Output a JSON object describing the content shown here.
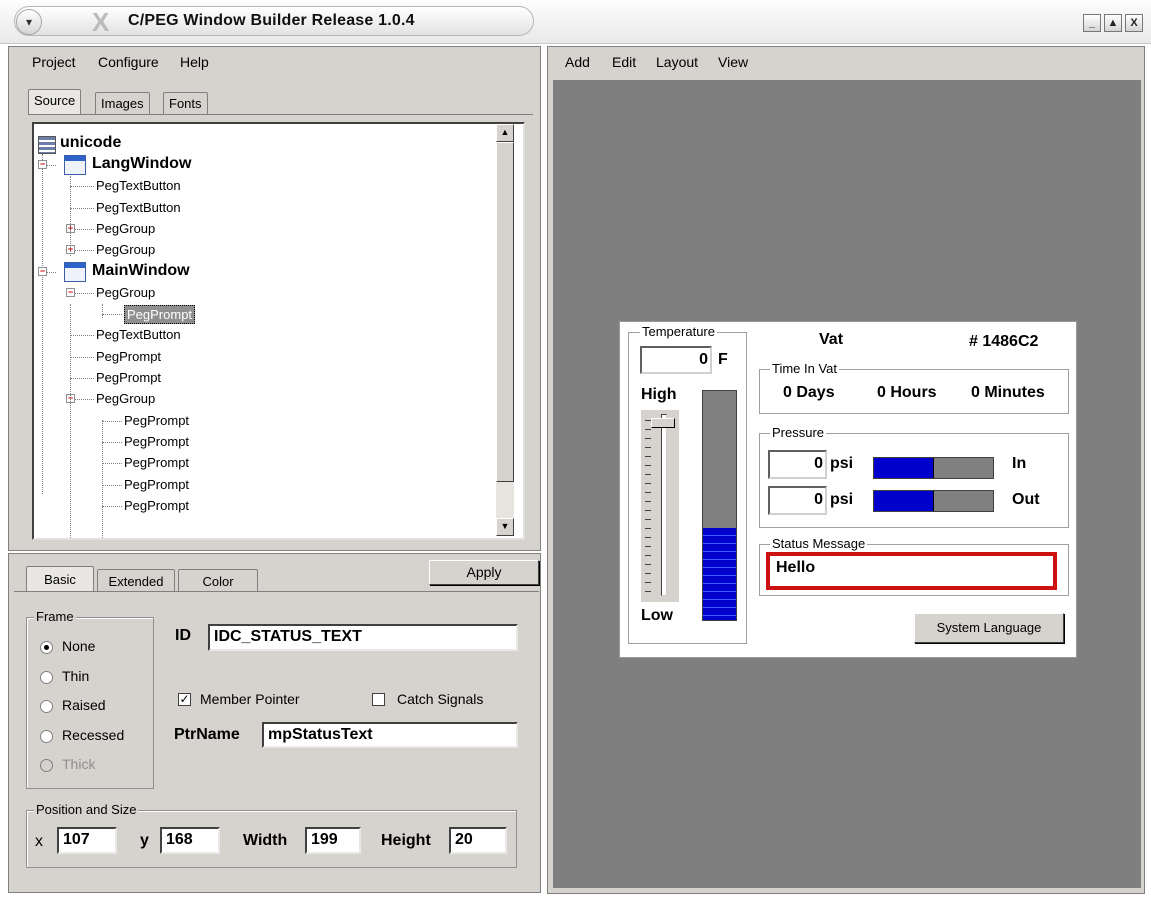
{
  "window": {
    "title": "C/PEG Window Builder Release 1.0.4",
    "logo_glyph": "X",
    "menu_glyph": "▾",
    "minimize_glyph": "_",
    "maximize_glyph": "▲",
    "close_glyph": "X"
  },
  "left_menu": [
    "Project",
    "Configure",
    "Help"
  ],
  "right_menu": [
    "Add",
    "Edit",
    "Layout",
    "View"
  ],
  "top_tabs": {
    "source": "Source",
    "images": "Images",
    "fonts": "Fonts",
    "active": "Source"
  },
  "tree": {
    "root": "unicode",
    "nodes": [
      {
        "label": "LangWindow",
        "level": 0,
        "bold": true,
        "window": true,
        "expander": "−"
      },
      {
        "label": "PegTextButton",
        "level": 1
      },
      {
        "label": "PegTextButton",
        "level": 1
      },
      {
        "label": "PegGroup",
        "level": 1,
        "expander": "+"
      },
      {
        "label": "PegGroup",
        "level": 1,
        "expander": "+"
      },
      {
        "label": "MainWindow",
        "level": 0,
        "bold": true,
        "window": true,
        "expander": "−"
      },
      {
        "label": "PegGroup",
        "level": 1,
        "expander": "−"
      },
      {
        "label": "PegPrompt",
        "level": 2,
        "selected": true
      },
      {
        "label": "PegTextButton",
        "level": 1
      },
      {
        "label": "PegPrompt",
        "level": 1
      },
      {
        "label": "PegPrompt",
        "level": 1
      },
      {
        "label": "PegGroup",
        "level": 1,
        "expander": "−"
      },
      {
        "label": "PegPrompt",
        "level": 2
      },
      {
        "label": "PegPrompt",
        "level": 2
      },
      {
        "label": "PegPrompt",
        "level": 2
      },
      {
        "label": "PegPrompt",
        "level": 2
      },
      {
        "label": "PegPrompt",
        "level": 2
      }
    ]
  },
  "props": {
    "tabs": {
      "basic": "Basic",
      "extended": "Extended",
      "color": "Color",
      "active": "Basic"
    },
    "apply_label": "Apply",
    "frame": {
      "label": "Frame",
      "options": [
        {
          "label": "None",
          "checked": true,
          "disabled": false
        },
        {
          "label": "Thin",
          "checked": false,
          "disabled": false
        },
        {
          "label": "Raised",
          "checked": false,
          "disabled": false
        },
        {
          "label": "Recessed",
          "checked": false,
          "disabled": false
        },
        {
          "label": "Thick",
          "checked": false,
          "disabled": true
        }
      ]
    },
    "id_label": "ID",
    "id_value": "IDC_STATUS_TEXT",
    "member_pointer": {
      "label": "Member Pointer",
      "checked": true,
      "mark": "✓"
    },
    "catch_signals": {
      "label": "Catch Signals",
      "checked": false
    },
    "ptrname_label": "PtrName",
    "ptrname_value": "mpStatusText",
    "position": {
      "label": "Position and Size",
      "x_label": "x",
      "x": "107",
      "y_label": "y",
      "y": "168",
      "width_label": "Width",
      "width": "199",
      "height_label": "Height",
      "height": "20"
    }
  },
  "preview": {
    "temperature": {
      "label": "Temperature",
      "value": "0",
      "unit": "F",
      "high": "High",
      "low": "Low",
      "level": 0.4
    },
    "vat_label": "Vat",
    "vat_id": "# 1486C2",
    "time_in_vat": {
      "label": "Time In Vat",
      "days": "0 Days",
      "hours": "0 Hours",
      "minutes": "0 Minutes"
    },
    "pressure": {
      "label": "Pressure",
      "unit": "psi",
      "in": {
        "value": "0",
        "label": "In",
        "fill": 0.5
      },
      "out": {
        "value": "0",
        "label": "Out",
        "fill": 0.5
      }
    },
    "status": {
      "label": "Status Message",
      "value": "Hello"
    },
    "system_language_label": "System Language",
    "colors": {
      "bar_fill": "#0000cc",
      "status_border": "#cc1111"
    }
  }
}
